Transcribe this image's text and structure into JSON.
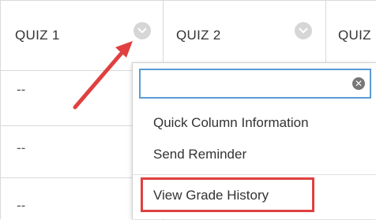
{
  "columns": [
    {
      "label": "QUIZ 1"
    },
    {
      "label": "QUIZ 2"
    },
    {
      "label": "QUIZ"
    }
  ],
  "rows": [
    "--",
    "--",
    "--"
  ],
  "menu": {
    "filter_value": "",
    "items": [
      "Quick Column Information",
      "Send Reminder",
      "View Grade History"
    ],
    "highlighted_item": "View Grade History"
  },
  "colors": {
    "annotation": "#e04040",
    "input_focus": "#5b9bd5",
    "grid": "#d9d9d9"
  },
  "icons": [
    "chevron-down-icon",
    "clear-icon",
    "annotation-arrow"
  ]
}
